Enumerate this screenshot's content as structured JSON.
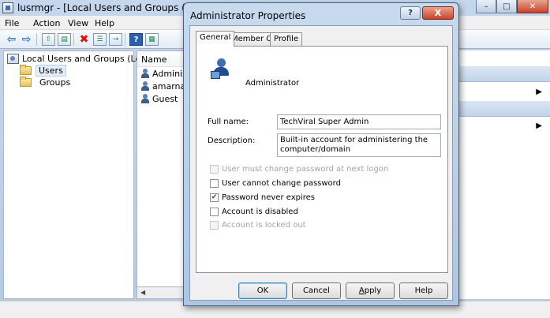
{
  "main_window": {
    "title": "lusrmgr - [Local Users and Groups (Local)\\Users]",
    "menu": [
      "File",
      "Action",
      "View",
      "Help"
    ],
    "toolbar_icons": [
      "back-arrow-icon",
      "forward-arrow-icon",
      "up-folder-icon",
      "show-hide-tree-icon",
      "delete-icon",
      "properties-icon",
      "export-list-icon",
      "help-icon",
      "show-hide-action-pane-icon"
    ],
    "tree": {
      "root": "Local Users and Groups (Local)",
      "items": [
        "Users",
        "Groups"
      ],
      "selected": "Users"
    },
    "list": {
      "column_name": "Name",
      "users": [
        "Administrator",
        "amarnath",
        "Guest"
      ]
    }
  },
  "dialog": {
    "title": "Administrator Properties",
    "help_glyph": "?",
    "close_glyph": "X",
    "tabs": [
      "General",
      "Member Of",
      "Profile"
    ],
    "active_tab": "General",
    "account_name": "Administrator",
    "full_name_label": "Full name:",
    "full_name_value": "TechViral Super Admin",
    "description_label": "Description:",
    "description_value": "Built-in account for administering the computer/domain",
    "checkboxes": [
      {
        "label": "User must change password at next logon",
        "checked": false,
        "enabled": false
      },
      {
        "label": "User cannot change password",
        "checked": false,
        "enabled": true
      },
      {
        "label": "Password never expires",
        "checked": true,
        "enabled": true
      },
      {
        "label": "Account is disabled",
        "checked": false,
        "enabled": true
      },
      {
        "label": "Account is locked out",
        "checked": false,
        "enabled": false
      }
    ],
    "buttons": {
      "ok": "OK",
      "cancel": "Cancel",
      "apply_prefix": "",
      "apply_u": "A",
      "apply_rest": "pply",
      "help": "Help"
    }
  }
}
